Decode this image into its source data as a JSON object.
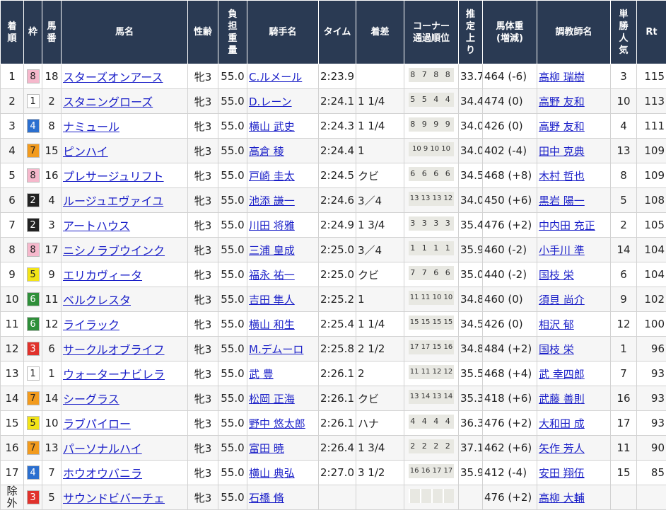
{
  "headers": {
    "rank": "着\n順",
    "waku": "枠",
    "umaban": "馬\n番",
    "horse": "馬名",
    "sexage": "性齢",
    "weight": "負\n担\n重\n量",
    "jockey": "騎手名",
    "time": "タイム",
    "margin": "着差",
    "corner": "コーナー\n通過順位",
    "last3f": "推\n定\n上\nり",
    "bodyweight": "馬体重\n(増減)",
    "trainer": "調教師名",
    "odds": "単\n勝\n人\n気",
    "rt": "Rt"
  },
  "waku_colors": {
    "1": {
      "bg": "#ffffff",
      "fg": "#222222"
    },
    "2": {
      "bg": "#222222",
      "fg": "#ffffff"
    },
    "3": {
      "bg": "#e0322c",
      "fg": "#ffffff"
    },
    "4": {
      "bg": "#2b6fcf",
      "fg": "#ffffff"
    },
    "5": {
      "bg": "#f2e418",
      "fg": "#222222"
    },
    "6": {
      "bg": "#2f8f3a",
      "fg": "#ffffff"
    },
    "7": {
      "bg": "#f29b1e",
      "fg": "#222222"
    },
    "8": {
      "bg": "#f6b8cc",
      "fg": "#222222"
    }
  },
  "rows": [
    {
      "rank": "1",
      "waku": "8",
      "umaban": "18",
      "horse": "スターズオンアース",
      "sexage": "牝3",
      "weight": "55.0",
      "jockey": "C.ルメール",
      "time": "2:23.9",
      "margin": "",
      "corner": "8 7 8 8",
      "last3f": "33.7",
      "bodyweight": "464 (-6)",
      "trainer": "高柳 瑞樹",
      "pop": "3",
      "rt": "115"
    },
    {
      "rank": "2",
      "waku": "1",
      "umaban": "2",
      "horse": "スタニングローズ",
      "sexage": "牝3",
      "weight": "55.0",
      "jockey": "D.レーン",
      "time": "2:24.1",
      "margin": "1 1/4",
      "corner": "5 5 4 4",
      "last3f": "34.4",
      "bodyweight": "474 (0)",
      "trainer": "高野 友和",
      "pop": "10",
      "rt": "113"
    },
    {
      "rank": "3",
      "waku": "4",
      "umaban": "8",
      "horse": "ナミュール",
      "sexage": "牝3",
      "weight": "55.0",
      "jockey": "横山 武史",
      "time": "2:24.3",
      "margin": "1 1/4",
      "corner": "8 9 9 9",
      "last3f": "34.0",
      "bodyweight": "426 (0)",
      "trainer": "高野 友和",
      "pop": "4",
      "rt": "111"
    },
    {
      "rank": "4",
      "waku": "7",
      "umaban": "15",
      "horse": "ピンハイ",
      "sexage": "牝3",
      "weight": "55.0",
      "jockey": "高倉 稜",
      "time": "2:24.4",
      "margin": "1",
      "corner": "10 9 10 10",
      "last3f": "34.0",
      "bodyweight": "402 (-4)",
      "trainer": "田中 克典",
      "pop": "13",
      "rt": "109"
    },
    {
      "rank": "5",
      "waku": "8",
      "umaban": "16",
      "horse": "プレサージュリフト",
      "sexage": "牝3",
      "weight": "55.0",
      "jockey": "戸崎 圭太",
      "time": "2:24.5",
      "margin": "クビ",
      "corner": "6 6 6 6",
      "last3f": "34.5",
      "bodyweight": "468 (+8)",
      "trainer": "木村 哲也",
      "pop": "8",
      "rt": "109"
    },
    {
      "rank": "6",
      "waku": "2",
      "umaban": "4",
      "horse": "ルージュエヴァイユ",
      "sexage": "牝3",
      "weight": "55.0",
      "jockey": "池添 謙一",
      "time": "2:24.6",
      "margin": "3／4",
      "corner": "13 13 13 12",
      "last3f": "34.0",
      "bodyweight": "450 (+6)",
      "trainer": "黒岩 陽一",
      "pop": "5",
      "rt": "108"
    },
    {
      "rank": "7",
      "waku": "2",
      "umaban": "3",
      "horse": "アートハウス",
      "sexage": "牝3",
      "weight": "55.0",
      "jockey": "川田 将雅",
      "time": "2:24.9",
      "margin": "1 3/4",
      "corner": "3 3 3 3",
      "last3f": "35.4",
      "bodyweight": "476 (+2)",
      "trainer": "中内田 充正",
      "pop": "2",
      "rt": "105"
    },
    {
      "rank": "8",
      "waku": "8",
      "umaban": "17",
      "horse": "ニシノラブウインク",
      "sexage": "牝3",
      "weight": "55.0",
      "jockey": "三浦 皇成",
      "time": "2:25.0",
      "margin": "3／4",
      "corner": "1 1 1 1",
      "last3f": "35.9",
      "bodyweight": "460 (-2)",
      "trainer": "小手川 準",
      "pop": "14",
      "rt": "104"
    },
    {
      "rank": "9",
      "waku": "5",
      "umaban": "9",
      "horse": "エリカヴィータ",
      "sexage": "牝3",
      "weight": "55.0",
      "jockey": "福永 祐一",
      "time": "2:25.0",
      "margin": "クビ",
      "corner": "7 7 6 6",
      "last3f": "35.0",
      "bodyweight": "440 (-2)",
      "trainer": "国枝 栄",
      "pop": "6",
      "rt": "104"
    },
    {
      "rank": "10",
      "waku": "6",
      "umaban": "11",
      "horse": "ベルクレスタ",
      "sexage": "牝3",
      "weight": "55.0",
      "jockey": "吉田 隼人",
      "time": "2:25.2",
      "margin": "1",
      "corner": "11 11 10 10",
      "last3f": "34.8",
      "bodyweight": "460 (0)",
      "trainer": "須貝 尚介",
      "pop": "9",
      "rt": "102"
    },
    {
      "rank": "11",
      "waku": "6",
      "umaban": "12",
      "horse": "ライラック",
      "sexage": "牝3",
      "weight": "55.0",
      "jockey": "横山 和生",
      "time": "2:25.4",
      "margin": "1 1/4",
      "corner": "15 15 15 15",
      "last3f": "34.5",
      "bodyweight": "426 (0)",
      "trainer": "相沢 郁",
      "pop": "12",
      "rt": "100"
    },
    {
      "rank": "12",
      "waku": "3",
      "umaban": "6",
      "horse": "サークルオブライフ",
      "sexage": "牝3",
      "weight": "55.0",
      "jockey": "M.デムーロ",
      "time": "2:25.8",
      "margin": "2 1/2",
      "corner": "17 17 15 16",
      "last3f": "34.8",
      "bodyweight": "484 (+2)",
      "trainer": "国枝 栄",
      "pop": "1",
      "rt": "96"
    },
    {
      "rank": "13",
      "waku": "1",
      "umaban": "1",
      "horse": "ウォーターナビレラ",
      "sexage": "牝3",
      "weight": "55.0",
      "jockey": "武 豊",
      "time": "2:26.1",
      "margin": "2",
      "corner": "11 11 12 12",
      "last3f": "35.5",
      "bodyweight": "468 (+4)",
      "trainer": "武 幸四郎",
      "pop": "7",
      "rt": "93"
    },
    {
      "rank": "14",
      "waku": "7",
      "umaban": "14",
      "horse": "シーグラス",
      "sexage": "牝3",
      "weight": "55.0",
      "jockey": "松岡 正海",
      "time": "2:26.1",
      "margin": "クビ",
      "corner": "13 14 13 14",
      "last3f": "35.3",
      "bodyweight": "418 (+6)",
      "trainer": "武藤 善則",
      "pop": "16",
      "rt": "93"
    },
    {
      "rank": "15",
      "waku": "5",
      "umaban": "10",
      "horse": "ラブパイロー",
      "sexage": "牝3",
      "weight": "55.0",
      "jockey": "野中 悠太郎",
      "time": "2:26.1",
      "margin": "ハナ",
      "corner": "4 4 4 4",
      "last3f": "36.3",
      "bodyweight": "476 (+2)",
      "trainer": "大和田 成",
      "pop": "17",
      "rt": "93"
    },
    {
      "rank": "16",
      "waku": "7",
      "umaban": "13",
      "horse": "パーソナルハイ",
      "sexage": "牝3",
      "weight": "55.0",
      "jockey": "富田 暁",
      "time": "2:26.4",
      "margin": "1 3/4",
      "corner": "2 2 2 2",
      "last3f": "37.1",
      "bodyweight": "462 (+6)",
      "trainer": "矢作 芳人",
      "pop": "11",
      "rt": "90"
    },
    {
      "rank": "17",
      "waku": "4",
      "umaban": "7",
      "horse": "ホウオウバニラ",
      "sexage": "牝3",
      "weight": "55.0",
      "jockey": "横山 典弘",
      "time": "2:27.0",
      "margin": "3 1/2",
      "corner": "16 16 17 17",
      "last3f": "35.9",
      "bodyweight": "412 (-4)",
      "trainer": "安田 翔伍",
      "pop": "15",
      "rt": "85"
    },
    {
      "rank": "除\n外",
      "waku": "3",
      "umaban": "5",
      "horse": "サウンドビバーチェ",
      "sexage": "牝3",
      "weight": "55.0",
      "jockey": "石橋 脩",
      "time": "",
      "margin": "",
      "corner": "",
      "last3f": "",
      "bodyweight": "476 (+2)",
      "trainer": "高柳 大輔",
      "pop": "",
      "rt": ""
    }
  ]
}
